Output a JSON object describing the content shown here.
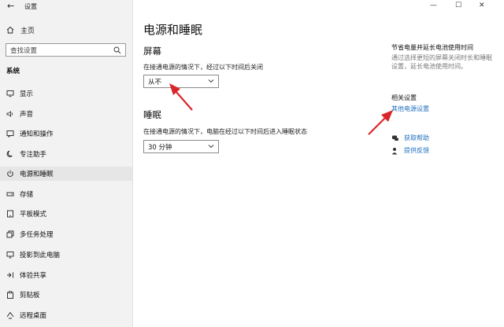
{
  "window": {
    "title": "设置",
    "back_glyph": "←",
    "minimize": "—",
    "maximize": "☐",
    "close": "✕"
  },
  "sidebar": {
    "home": "主页",
    "search_placeholder": "查找设置",
    "section": "系统",
    "items": [
      {
        "label": "显示",
        "icon": "display-icon"
      },
      {
        "label": "声音",
        "icon": "sound-icon"
      },
      {
        "label": "通知和操作",
        "icon": "notification-icon"
      },
      {
        "label": "专注助手",
        "icon": "focus-icon"
      },
      {
        "label": "电源和睡眠",
        "icon": "power-icon",
        "active": true
      },
      {
        "label": "存储",
        "icon": "storage-icon"
      },
      {
        "label": "平板模式",
        "icon": "tablet-icon"
      },
      {
        "label": "多任务处理",
        "icon": "multitask-icon"
      },
      {
        "label": "投影到此电脑",
        "icon": "project-icon"
      },
      {
        "label": "体验共享",
        "icon": "share-icon"
      },
      {
        "label": "剪贴板",
        "icon": "clipboard-icon"
      },
      {
        "label": "远程桌面",
        "icon": "remote-icon"
      }
    ]
  },
  "main": {
    "title": "电源和睡眠",
    "screen": {
      "heading": "屏幕",
      "desc": "在接通电源的情况下，经过以下时间后关闭",
      "value": "从不"
    },
    "sleep": {
      "heading": "睡眠",
      "desc": "在接通电源的情况下，电脑在经过以下时间后进入睡眠状态",
      "value": "30 分钟"
    }
  },
  "right": {
    "tip_heading": "节省电量并延长电池使用时间",
    "tip_desc": "通过选择更短的屏幕关闭时长和睡眠设置，延长电池使用时间。",
    "related_heading": "相关设置",
    "related_link": "其他电源设置",
    "help": "获取帮助",
    "feedback": "提供反馈"
  },
  "colors": {
    "accent": "#1f6fbf",
    "annotation_arrow": "#d9262b"
  }
}
